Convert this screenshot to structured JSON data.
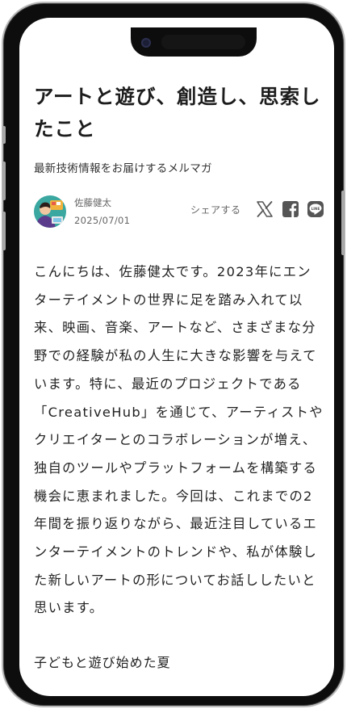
{
  "article": {
    "title": "アートと遊び、創造し、思索したこと",
    "subtitle": "最新技術情報をお届けするメルマガ",
    "author": "佐藤健太",
    "date": "2025/07/01",
    "share_label": "シェアする",
    "share_icons": [
      "x-logo-icon",
      "facebook-icon",
      "line-icon"
    ],
    "body": "こんにちは、佐藤健太です。2023年にエンターテイメントの世界に足を踏み入れて以来、映画、音楽、アートなど、さまざまな分野での経験が私の人生に大きな影響を与えています。特に、最近のプロジェクトである「CreativeHub」を通じて、アーティストやクリエイターとのコラボレーションが増え、独自のツールやプラットフォームを構築する機会に恵まれました。今回は、これまでの2年間を振り返りながら、最近注目しているエンターテイメントのトレンドや、私が体験した新しいアートの形についてお話ししたいと思います。",
    "section_heading": "子どもと遊び始めた夏"
  },
  "colors": {
    "text": "#222222",
    "muted": "#666666",
    "icon": "#555555",
    "frame": "#0d0d0d"
  }
}
